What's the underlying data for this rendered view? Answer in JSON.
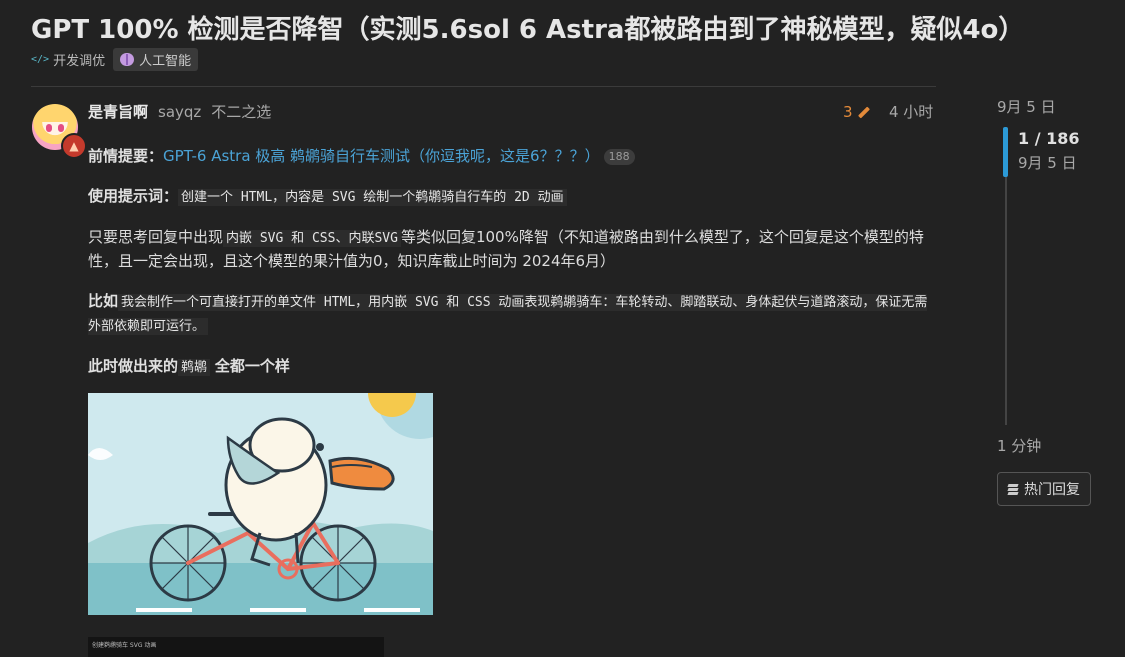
{
  "topic": {
    "title": "GPT 100% 检测是否降智（实测5.6sol 6 Astra都被路由到了神秘模型，疑似4o）",
    "category": "开发调优",
    "category_icon": "</>",
    "tag": "人工智能"
  },
  "post": {
    "username": "是青旨啊",
    "handle": "sayqz",
    "user_title": "不二之选",
    "edit_count": "3",
    "age": "4 小时",
    "p1_label": "前情提要：",
    "p1_link": "GPT-6 Astra 极高 鹈鹕骑自行车测试（你逗我呢，这是6？？？）",
    "p1_badge": "188",
    "p2_label": "使用提示词：",
    "p2_code": "创建一个 HTML，内容是 SVG 绘制一个鹈鹕骑自行车的 2D 动画",
    "p3_a": "只要思考回复中出现",
    "p3_code": "内嵌 SVG 和 CSS、内联SVG",
    "p3_b": "等类似回复100%降智（不知道被路由到什么模型了，这个回复是这个模型的特性，且一定会出现，且这个模型的果汁值为0，知识库截止时间为 2024年6月）",
    "p4_label": "比如",
    "p4_code": "我会制作一个可直接打开的单文件 HTML，用内嵌 SVG 和 CSS 动画表现鹈鹕骑车：车轮转动、脚踏联动、身体起伏与道路滚动，保证无需外部依赖即可运行。",
    "p5_a": "此时做出来的",
    "p5_code": "鹈鹕",
    "p5_b": "全都一个样",
    "image2_caption": "创建鹈鹕骑车 SVG 动画"
  },
  "timeline": {
    "start_date": "9月 5 日",
    "position": "1 / 186",
    "current_date": "9月 5 日",
    "end_label": "1 分钟",
    "hot_replies_label": "热门回复"
  },
  "colors": {
    "background": "#222222",
    "link": "#4ba3d6",
    "edit_accent": "#e38a3a",
    "timeline_accent": "#2c9ad7"
  }
}
